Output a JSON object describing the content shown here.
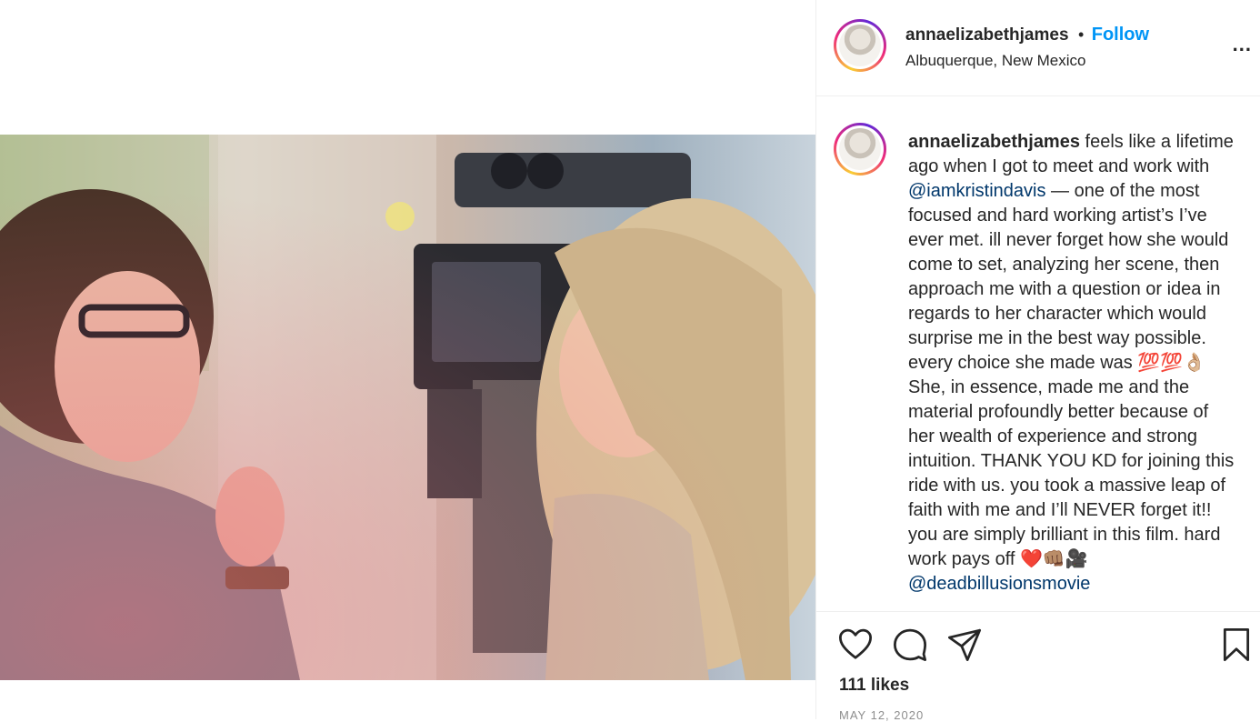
{
  "post": {
    "username": "annaelizabethjames",
    "follow_label": "Follow",
    "location": "Albuquerque, New Mexico",
    "more_label": "...",
    "caption": {
      "username": "annaelizabethjames",
      "part1": "feels like a lifetime ago when I got to meet and work with ",
      "mention1": "@iamkristindavis",
      "part2": " — one of the most focused and hard working artist’s I’ve ever met. ill never forget how she would come to set, analyzing her scene, then approach me with a question or idea in regards to her character which would surprise me in the best way possible. every choice she made was ",
      "emoji1": "💯💯👌🏼",
      "part3": " She, in essence, made me and the material profoundly better because of her wealth of experience and strong intuition. THANK YOU KD for joining this ride with us. you took a massive leap of faith with me and I’ll NEVER forget it!! you are simply brilliant in this film. hard work pays off ",
      "emoji2": "❤️👊🏽🎥",
      "mention2": "@deadbillusionsmovie"
    },
    "likes": "111 likes",
    "date": "MAY 12, 2020"
  },
  "icons": {
    "like": "heart-icon",
    "comment": "comment-icon",
    "share": "share-icon",
    "save": "bookmark-icon",
    "more": "more-options-icon"
  },
  "colors": {
    "follow": "#0095f6",
    "mention": "#00376b",
    "meta": "#8e8e8e"
  }
}
